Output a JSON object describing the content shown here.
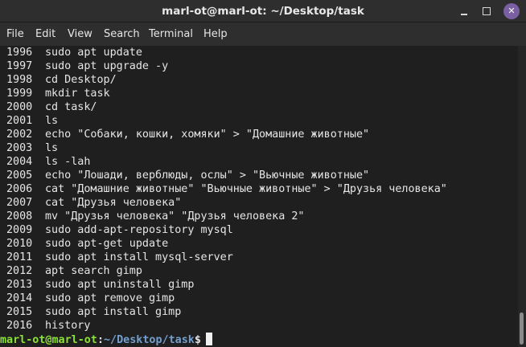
{
  "window": {
    "title": "marl-ot@marl-ot: ~/Desktop/task",
    "buttons": {
      "minimize_icon": "minimize-icon",
      "maximize_icon": "maximize-icon",
      "close_icon": "close-icon",
      "close_glyph": "✕"
    },
    "colors": {
      "background": "#1f1f1f",
      "titlebar": "#2e2e2e",
      "close_button": "#7b5fa3",
      "prompt_user": "#8ae234",
      "prompt_path": "#729fcf"
    }
  },
  "menu": {
    "file": "File",
    "edit": "Edit",
    "view": "View",
    "search": "Search",
    "terminal": "Terminal",
    "help": "Help"
  },
  "history": [
    {
      "num": "1996",
      "cmd": "sudo apt update"
    },
    {
      "num": "1997",
      "cmd": "sudo apt upgrade -y"
    },
    {
      "num": "1998",
      "cmd": "cd Desktop/"
    },
    {
      "num": "1999",
      "cmd": "mkdir task"
    },
    {
      "num": "2000",
      "cmd": "cd task/"
    },
    {
      "num": "2001",
      "cmd": "ls"
    },
    {
      "num": "2002",
      "cmd": "echo \"Собаки, кошки, хомяки\" > \"Домашние животные\""
    },
    {
      "num": "2003",
      "cmd": "ls"
    },
    {
      "num": "2004",
      "cmd": "ls -lah"
    },
    {
      "num": "2005",
      "cmd": "echo \"Лошади, верблюды, ослы\" > \"Вьючные животные\""
    },
    {
      "num": "2006",
      "cmd": "cat \"Домашние животные\" \"Вьючные животные\" > \"Друзья человека\""
    },
    {
      "num": "2007",
      "cmd": "cat \"Друзья человека\""
    },
    {
      "num": "2008",
      "cmd": "mv \"Друзья человека\" \"Друзья человека 2\""
    },
    {
      "num": "2009",
      "cmd": "sudo add-apt-repository mysql"
    },
    {
      "num": "2010",
      "cmd": "sudo apt-get update"
    },
    {
      "num": "2011",
      "cmd": "sudo apt install mysql-server"
    },
    {
      "num": "2012",
      "cmd": "apt search gimp"
    },
    {
      "num": "2013",
      "cmd": "sudo apt uninstall gimp"
    },
    {
      "num": "2014",
      "cmd": "sudo apt remove gimp"
    },
    {
      "num": "2015",
      "cmd": "sudo apt install gimp"
    },
    {
      "num": "2016",
      "cmd": "history"
    }
  ],
  "prompt": {
    "user_host": "marl-ot@marl-ot",
    "colon": ":",
    "path": "~/Desktop/task",
    "symbol": "$"
  },
  "scrollbar": {
    "position": 1.0
  }
}
